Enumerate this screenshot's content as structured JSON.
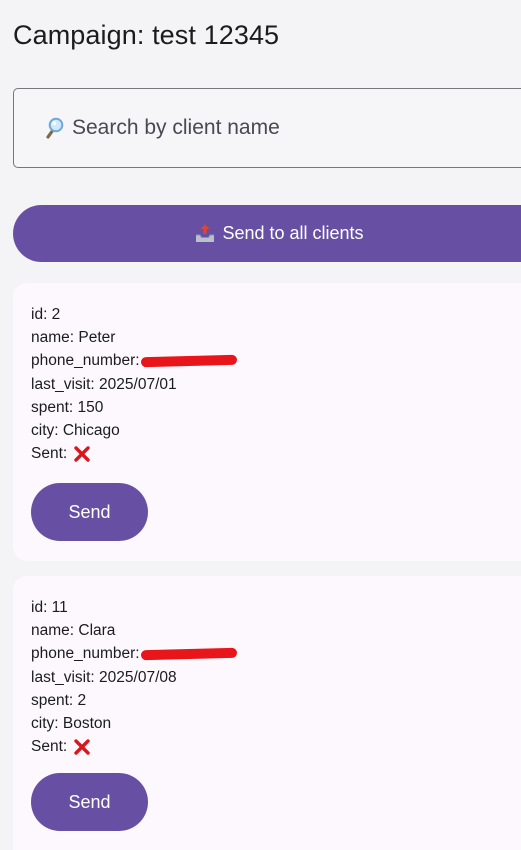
{
  "page": {
    "title": "Campaign: test 12345"
  },
  "search": {
    "placeholder": "Search by client name",
    "icon": "magnifying-glass-icon"
  },
  "send_all": {
    "label": "Send to all clients",
    "icon": "outbox-tray-icon"
  },
  "clients": [
    {
      "id_line": "id: 2",
      "name_line": "name: Peter",
      "phone_label": "phone_number:",
      "phone_redacted": true,
      "last_visit_line": "last_visit: 2025/07/01",
      "spent_line": "spent: 150",
      "city_line": "city: Chicago",
      "sent_label": "Sent:",
      "sent_status_icon": "cross-mark-icon",
      "send_label": "Send"
    },
    {
      "id_line": "id: 11",
      "name_line": "name: Clara",
      "phone_label": "phone_number:",
      "phone_redacted": true,
      "last_visit_line": "last_visit: 2025/07/08",
      "spent_line": "spent: 2",
      "city_line": "city: Boston",
      "sent_label": "Sent:",
      "sent_status_icon": "cross-mark-icon",
      "send_label": "Send"
    }
  ],
  "colors": {
    "primary": "#6750a4",
    "card_background": "#fdf8fd",
    "page_background": "#f4f3f5",
    "redaction": "#e8151b",
    "cross_mark": "#d8161c"
  }
}
